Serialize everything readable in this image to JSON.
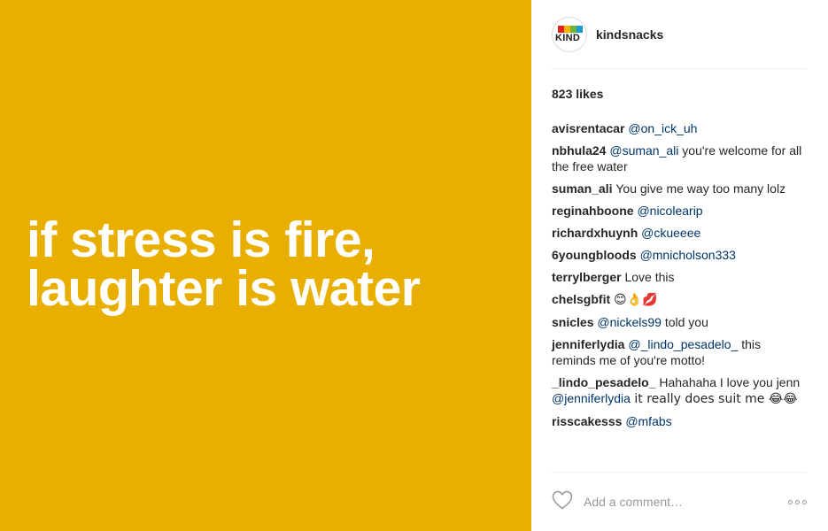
{
  "media": {
    "line1": "if stress is fire,",
    "line2": "laughter is water",
    "background_color": "#e8ae00"
  },
  "header": {
    "username": "kindsnacks",
    "avatar_logo_text": "KIND"
  },
  "likes": "823 likes",
  "comments": [
    {
      "user": "avisrentacar",
      "mention": "@on_ick_uh",
      "text": ""
    },
    {
      "user": "nbhula24",
      "mention": "@suman_ali",
      "text": " you're welcome for all the free water"
    },
    {
      "user": "suman_ali",
      "mention": "",
      "text": "You give me way too many lolz"
    },
    {
      "user": "reginahboone",
      "mention": "@nicolearip",
      "text": ""
    },
    {
      "user": "richardxhuynh",
      "mention": "@ckueeee",
      "text": ""
    },
    {
      "user": "6youngbloods",
      "mention": "@mnicholson333",
      "text": ""
    },
    {
      "user": "terrylberger",
      "mention": "",
      "text": "Love this"
    },
    {
      "user": "chelsgbfit",
      "mention": "",
      "text": "😊👌💋"
    },
    {
      "user": "snicles",
      "mention": "@nickels99",
      "text": " told you"
    },
    {
      "user": "jenniferlydia",
      "mention": "@_lindo_pesadelo_",
      "text": " this reminds me of you're motto!"
    },
    {
      "user": "_lindo_pesadelo_",
      "mention": "",
      "text": "Hahahaha I love you jenn "
    },
    {
      "user": "risscakesss",
      "mention": "@mfabs",
      "text": ""
    }
  ],
  "comment_11_extra": {
    "mention": "@jenniferlydia",
    "text": " it really does suit me 😂😂"
  },
  "footer": {
    "add_comment_placeholder": "Add a comment…",
    "heart_icon": "heart-outline-icon",
    "more_icon": "more-options-icon"
  }
}
